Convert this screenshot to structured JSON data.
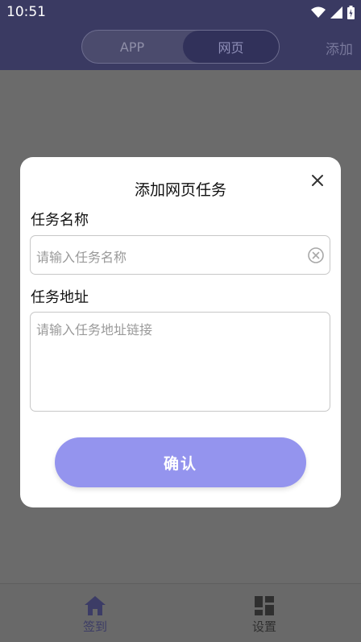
{
  "status": {
    "time": "10:51"
  },
  "header": {
    "segments": {
      "app": "APP",
      "web": "网页"
    },
    "add_label": "添加"
  },
  "dialog": {
    "title": "添加网页任务",
    "name_label": "任务名称",
    "name_placeholder": "请输入任务名称",
    "address_label": "任务地址",
    "address_placeholder": "请输入任务地址链接",
    "confirm_label": "确认"
  },
  "bottom_nav": {
    "items": [
      {
        "label": "签到",
        "icon": "home-icon"
      },
      {
        "label": "设置",
        "icon": "dashboard-icon"
      }
    ]
  },
  "colors": {
    "accent": "#9494ee",
    "header_bg": "#3a3a62",
    "overlay": "#6b6b6b"
  }
}
